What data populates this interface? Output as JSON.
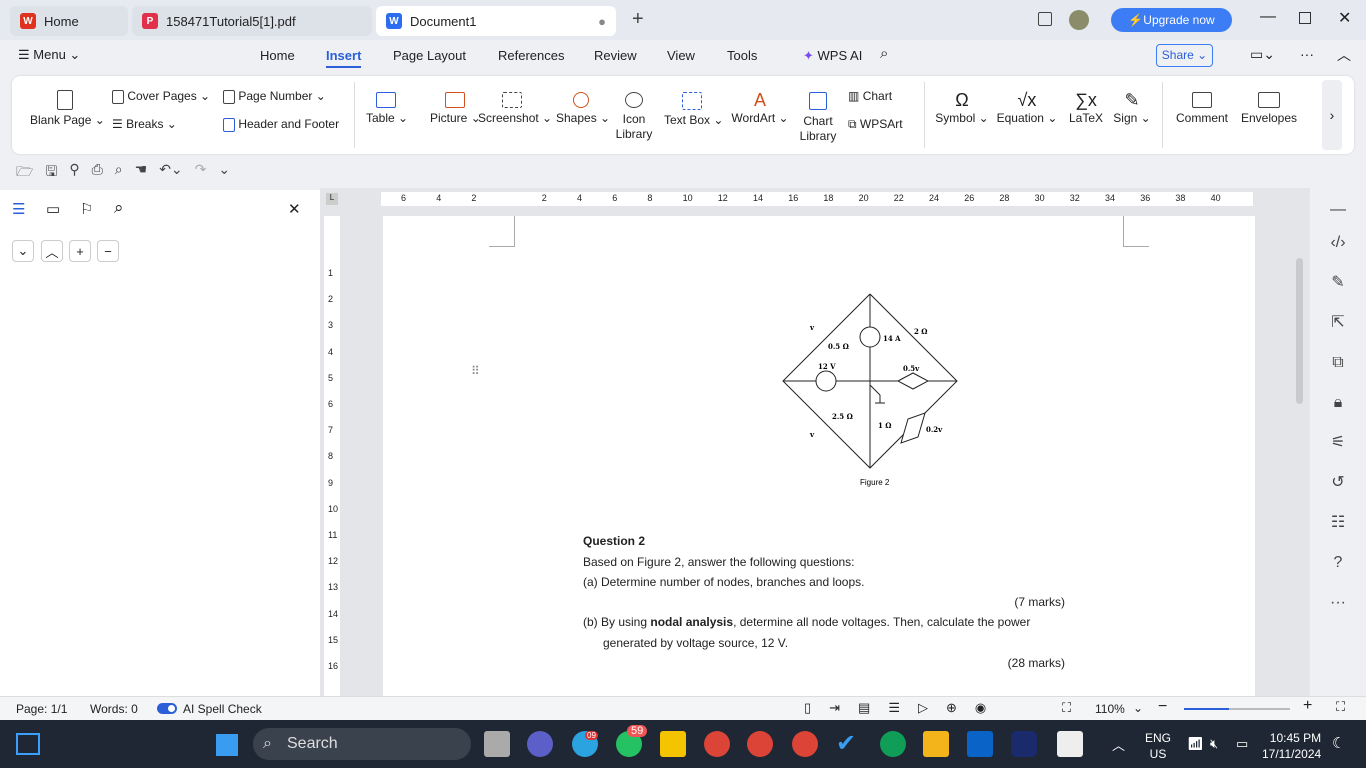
{
  "tabs": [
    {
      "label": "Home",
      "icon": "wps-logo",
      "color": "#e0301e"
    },
    {
      "label": "158471Tutorial5[1].pdf",
      "icon": "pdf-icon",
      "color": "#e0304a"
    },
    {
      "label": "Document1",
      "icon": "writer-icon",
      "color": "#2b6cf0",
      "active": true
    }
  ],
  "titlebar": {
    "upgrade": "Upgrade now",
    "accent": "#3c7cf5"
  },
  "menu": {
    "label": "Menu",
    "tabs": [
      "Home",
      "Insert",
      "Page Layout",
      "References",
      "Review",
      "View",
      "Tools"
    ],
    "active": "Insert",
    "wps_ai": "WPS AI",
    "share": "Share"
  },
  "ribbon": {
    "blank_page": "Blank Page",
    "cover_pages": "Cover Pages",
    "breaks": "Breaks",
    "page_number": "Page Number",
    "header_footer": "Header and Footer",
    "table": "Table",
    "picture": "Picture",
    "screenshot": "Screenshot",
    "shapes": "Shapes",
    "icon_library": [
      "Icon",
      "Library"
    ],
    "text_box": "Text Box",
    "wordart": "WordArt",
    "chart_library": [
      "Chart",
      "Library"
    ],
    "chart": "Chart",
    "wpsart": "WPSArt",
    "symbol": "Symbol",
    "equation": "Equation",
    "latex": "LaTeX",
    "sign": "Sign",
    "comment": "Comment",
    "envelopes": "Envelopes"
  },
  "ruler": {
    "h": [
      "6",
      "4",
      "2",
      "",
      "2",
      "4",
      "6",
      "8",
      "10",
      "12",
      "14",
      "16",
      "18",
      "20",
      "22",
      "24",
      "26",
      "28",
      "30",
      "32",
      "34",
      "36",
      "38",
      "40"
    ],
    "v": [
      "1",
      "2",
      "3",
      "4",
      "5",
      "6",
      "7",
      "8",
      "9",
      "10",
      "11",
      "12",
      "13",
      "14",
      "15",
      "16"
    ]
  },
  "figure": {
    "caption": "Figure 2",
    "labels": {
      "r1": "0.5 Ω",
      "r2": "2 Ω",
      "i1": "14 A",
      "v1": "12 V",
      "dep1": "0.5v",
      "r3": "2.5 Ω",
      "r4": "1 Ω",
      "dep2": "0.2v",
      "vx": "v",
      "vy": "v"
    }
  },
  "document": {
    "q_title": "Question 2",
    "intro": "Based on Figure 2, answer the following questions:",
    "a": "(a) Determine number of nodes, branches and loops.",
    "a_marks": "(7 marks)",
    "b_pre": "(b) By using ",
    "b_bold": "nodal analysis",
    "b_post": ", determine all node voltages. Then, calculate the power",
    "b_line2": "generated by voltage source, 12 V.",
    "b_marks": "(28 marks)"
  },
  "status": {
    "page": "Page: 1/1",
    "words": "Words: 0",
    "spell": "AI Spell Check",
    "zoom": "110%",
    "zoom_fraction": 0.42
  },
  "taskbar": {
    "search": "Search",
    "badge1": "09",
    "badge2": "59",
    "lang1": "ENG",
    "lang2": "US",
    "time": "10:45 PM",
    "date": "17/11/2024"
  }
}
